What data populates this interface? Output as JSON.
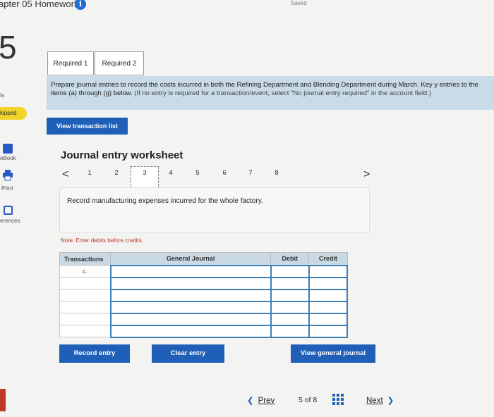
{
  "header": {
    "title": "apter 05 Homework",
    "info_icon": "info-icon",
    "saved": "Saved"
  },
  "rail": {
    "question_number": "5",
    "points": "ts",
    "status": "kipped",
    "ebook": "eBook",
    "print": "Print",
    "references": "erences"
  },
  "tabs": [
    {
      "label": "Required 1"
    },
    {
      "label": "Required 2"
    }
  ],
  "instructions": {
    "main": "Prepare journal entries to record the costs incurred in both the Refining Department and Blending Department during March. Key y entries to the items (a) through (g) below.",
    "note": "(If no entry is required for a transaction/event, select \"No journal entry required\" in the account field.)"
  },
  "view_transaction_list": "View transaction list",
  "worksheet": {
    "title": "Journal entry worksheet",
    "steps": [
      "1",
      "2",
      "3",
      "4",
      "5",
      "6",
      "7",
      "8"
    ],
    "current_step": "3",
    "prev_arrow": "<",
    "next_arrow": ">",
    "description": "Record manufacturing expenses incurred for the whole factory.",
    "note": "Note: Enter debits before credits.",
    "columns": [
      "Transactions",
      "General Journal",
      "Debit",
      "Credit"
    ],
    "rows": [
      {
        "transaction": "c.",
        "account": "",
        "debit": "",
        "credit": ""
      },
      {
        "transaction": "",
        "account": "",
        "debit": "",
        "credit": ""
      },
      {
        "transaction": "",
        "account": "",
        "debit": "",
        "credit": ""
      },
      {
        "transaction": "",
        "account": "",
        "debit": "",
        "credit": ""
      },
      {
        "transaction": "",
        "account": "",
        "debit": "",
        "credit": ""
      },
      {
        "transaction": "",
        "account": "",
        "debit": "",
        "credit": ""
      }
    ],
    "buttons": {
      "record": "Record entry",
      "clear": "Clear entry",
      "view_gj": "View general journal"
    }
  },
  "footer": {
    "prev": "Prev",
    "page": "5 of 8",
    "next": "Next"
  },
  "colors": {
    "accent": "#1f5fb8",
    "panel": "#c8dbe6",
    "note_red": "#c2362b",
    "skipped": "#f1d32a"
  }
}
